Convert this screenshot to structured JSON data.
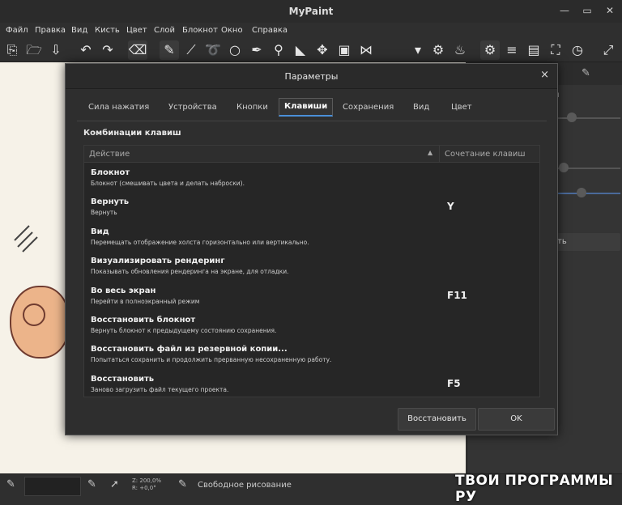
{
  "app": {
    "title": "MyPaint"
  },
  "menu": [
    "Файл",
    "Правка",
    "Вид",
    "Кисть",
    "Цвет",
    "Слой",
    "Блокнот",
    "Окно",
    "Справка"
  ],
  "right_panel": {
    "partial_text": "ки",
    "button_text": "ть"
  },
  "status": {
    "zoom": "Z: 200,0%",
    "rotation": "R: +0,0°",
    "mode": "Свободное рисование"
  },
  "watermark": "ТВОИ ПРОГРАММЫ РУ",
  "dialog": {
    "title": "Параметры",
    "close": "×",
    "tabs": [
      "Сила нажатия",
      "Устройства",
      "Кнопки",
      "Клавиши",
      "Сохранения",
      "Вид",
      "Цвет"
    ],
    "active_tab": "Клавиши",
    "section_title": "Комбинации клавиш",
    "columns": {
      "action": "Действие",
      "shortcut": "Сочетание клавиш",
      "sort": "▲"
    },
    "rows": [
      {
        "action": "Блокнот",
        "desc": "Блокнот (смешивать цвета и делать наброски).",
        "key": ""
      },
      {
        "action": "Вернуть",
        "desc": "Вернуть",
        "key": "Y"
      },
      {
        "action": "Вид",
        "desc": "Перемещать отображение холста горизонтально или вертикально.",
        "key": ""
      },
      {
        "action": "Визуализировать рендеринг",
        "desc": "Показывать обновления рендеринга на экране, для отладки.",
        "key": ""
      },
      {
        "action": "Во весь экран",
        "desc": "Перейти в полноэкранный режим",
        "key": "F11"
      },
      {
        "action": "Восстановить блокнот",
        "desc": "Вернуть блокнот к предыдущему состоянию сохранения.",
        "key": ""
      },
      {
        "action": "Восстановить файл из резервной копии...",
        "desc": "Попытаться сохранить и продолжить прерванную несохраненную работу.",
        "key": ""
      },
      {
        "action": "Восстановить",
        "desc": "Заново загрузить файл текущего проекта.",
        "key": "F5"
      }
    ],
    "buttons": {
      "revert": "Восстановить",
      "ok": "OK"
    }
  },
  "colors": {
    "accent": "#4a8fd8",
    "bg": "#2e2e2e"
  }
}
